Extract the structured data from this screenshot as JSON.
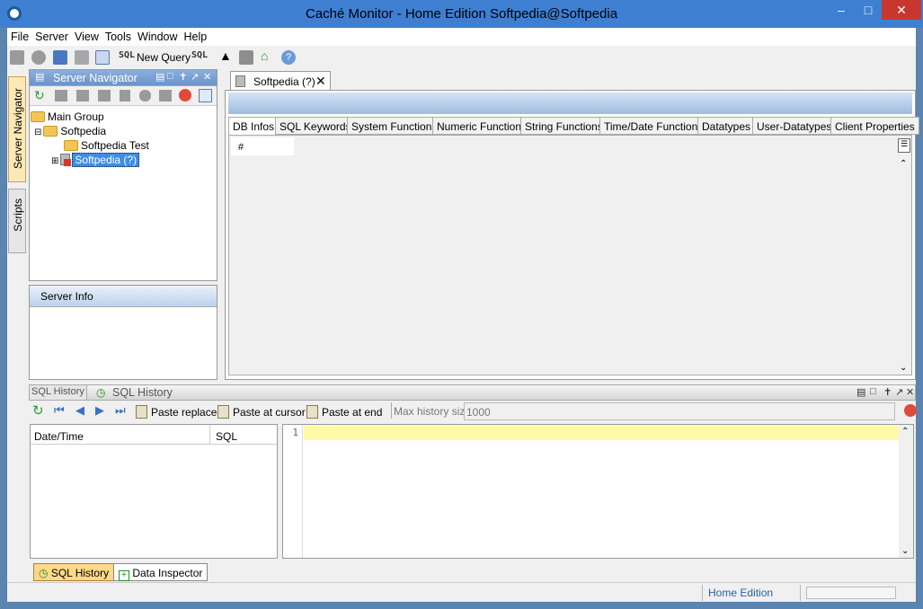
{
  "window": {
    "title": "Caché Monitor - Home Edition  Softpedia@Softpedia"
  },
  "menu": [
    "File",
    "Server",
    "View",
    "Tools",
    "Window",
    "Help"
  ],
  "toolbar": {
    "sql_label": "SQL",
    "new_query": "New Query",
    "sql_label2": "SQL"
  },
  "side_tabs": {
    "server_navigator": "Server Navigator",
    "scripts": "Scripts"
  },
  "server_navigator": {
    "title": "Server Navigator",
    "tree": [
      {
        "label": "Main Group"
      },
      {
        "label": "Softpedia"
      },
      {
        "label": "Softpedia Test"
      },
      {
        "label": "Softpedia (?)"
      }
    ]
  },
  "server_info": {
    "title": "Server Info"
  },
  "doc_tab": {
    "label": "Softpedia (?)"
  },
  "subtabs": [
    "DB Infos",
    "SQL Keywords",
    "System Functions",
    "Numeric Functions",
    "String Functions",
    "Time/Date Functions",
    "Datatypes",
    "User-Datatypes",
    "Client Properties"
  ],
  "grid": {
    "header": "#"
  },
  "sql_history": {
    "tab_inactive": "SQL History",
    "tab_active": "SQL History",
    "toolbar": {
      "paste_replace": "Paste replace",
      "paste_cursor": "Paste at cursor",
      "paste_end": "Paste at end",
      "max_history_label": "Max history size",
      "max_history_value": "1000"
    },
    "columns": [
      "Date/Time",
      "SQL"
    ],
    "line_number": "1"
  },
  "bottom_tabs": {
    "sql_history": "SQL History",
    "data_inspector": "Data Inspector"
  },
  "status": {
    "edition": "Home Edition"
  }
}
